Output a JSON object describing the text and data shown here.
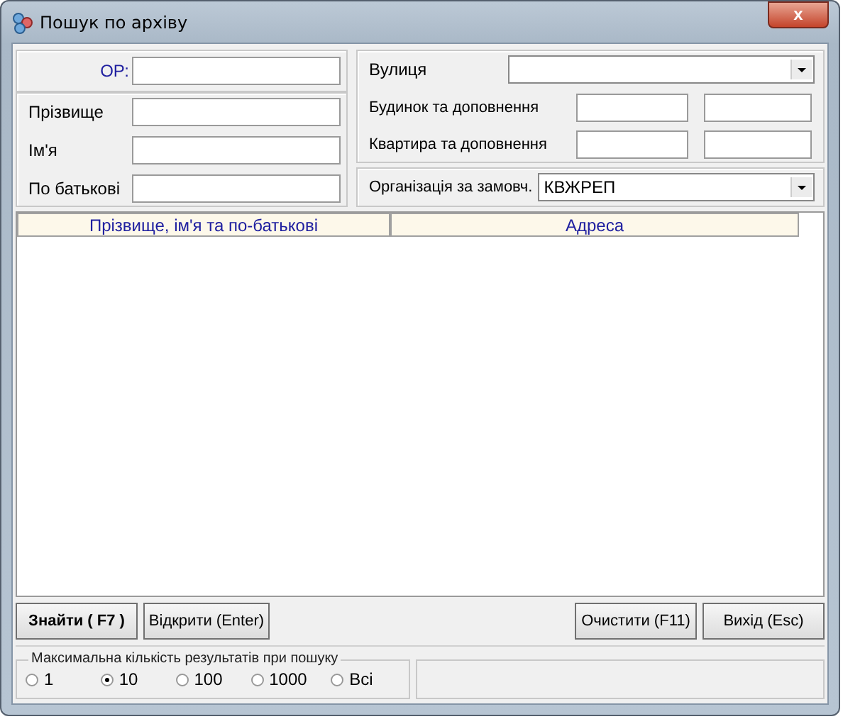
{
  "window": {
    "title": "Пошук по архіву",
    "close": "x"
  },
  "person": {
    "or_label": "ОР:",
    "fields": [
      {
        "label": "Прізвище"
      },
      {
        "label": "Ім'я"
      },
      {
        "label": "По батькові"
      }
    ]
  },
  "address": {
    "street_label": "Вулиця",
    "rows": [
      {
        "label": "Будинок та доповнення"
      },
      {
        "label": "Квартира та доповнення"
      }
    ]
  },
  "organization": {
    "label": "Організація за замовч.",
    "value": "КВЖРЕП"
  },
  "table": {
    "columns": [
      "Прізвище, ім'я та по-батькові",
      "Адреса"
    ]
  },
  "buttons": {
    "left": [
      {
        "label": "Знайти ( F7 )",
        "bold": true
      },
      {
        "label": "Відкрити (Enter)",
        "bold": false
      }
    ],
    "right": [
      {
        "label": "Очистити (F11)",
        "bold": false
      },
      {
        "label": "Вихід (Esc)",
        "bold": false
      }
    ]
  },
  "max_results": {
    "legend": "Максимальна кількість результатів при пошуку",
    "options": [
      {
        "label": "1",
        "selected": false
      },
      {
        "label": "10",
        "selected": true
      },
      {
        "label": "100",
        "selected": false
      },
      {
        "label": "1000",
        "selected": false
      },
      {
        "label": "Всі",
        "selected": false
      }
    ]
  }
}
